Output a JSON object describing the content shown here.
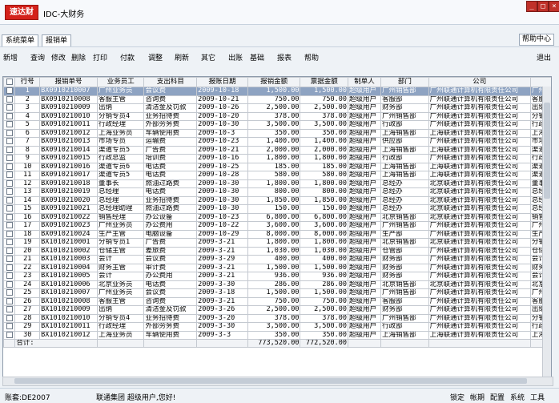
{
  "app": {
    "logo": "速达财",
    "title": "IDC-大财务"
  },
  "tabs": [
    "系统菜单",
    "报销单"
  ],
  "help_label": "帮助中心",
  "menu": [
    "新增",
    "查询",
    "修改",
    "删除",
    "打印",
    "付款",
    "调整",
    "刷新",
    "其它",
    "出账",
    "基础",
    "报表",
    "帮助"
  ],
  "exit_label": "退出",
  "columns": [
    "行号",
    "报销单号",
    "业务员工",
    "支出科目",
    "报账日期",
    "报销金额",
    "票据金额",
    "制单人",
    "部门",
    "公司"
  ],
  "rows": [
    [
      "1",
      "BX0910210007",
      "广州业务员",
      "会议费",
      "2009-10-18",
      "1,500.00",
      "1,500.00",
      "超级用户",
      "广州销售部",
      "广州联通计算机有限责任公司",
      "广州"
    ],
    [
      "2",
      "BX0910210008",
      "客服主管",
      "咨询费",
      "2009-10-21",
      "750.00",
      "750.00",
      "超级用户",
      "客服部",
      "广州联通计算机有限责任公司",
      "客服"
    ],
    [
      "3",
      "BX0910210009",
      "出纳",
      "清洁金及罚款",
      "2009-10-26",
      "2,500.00",
      "2,500.00",
      "超级用户",
      "财务部",
      "广州联通计算机有限责任公司",
      "出纳"
    ],
    [
      "4",
      "BX0910210010",
      "分销专员4",
      "业务招待费",
      "2009-10-20",
      "378.00",
      "378.00",
      "超级用户",
      "广州销售部",
      "广州联通计算机有限责任公司",
      "分销专"
    ],
    [
      "5",
      "BX0910210011",
      "行政经理",
      "外部劳务费",
      "2009-10-30",
      "3,500.00",
      "3,500.00",
      "超级用户",
      "行政部",
      "广州联通计算机有限责任公司",
      "行政经"
    ],
    [
      "6",
      "BX0910210012",
      "上海业务员",
      "车辆使用费",
      "2009-10-3",
      "350.00",
      "350.00",
      "超级用户",
      "上海销售部",
      "上海联通计算机有限责任公司",
      "上海业"
    ],
    [
      "7",
      "BX0910210013",
      "市场专员",
      "运输费",
      "2009-10-23",
      "1,400.00",
      "1,400.00",
      "超级用户",
      "供应部",
      "广州联通计算机有限责任公司",
      "市场专"
    ],
    [
      "8",
      "BX0910210014",
      "渠道专员5",
      "广告费",
      "2009-10-21",
      "2,000.00",
      "2,000.00",
      "超级用户",
      "上海销售部",
      "上海联通计算机有限责任公司",
      "渠道专"
    ],
    [
      "9",
      "BX0910210015",
      "行政总监",
      "培训费",
      "2009-10-16",
      "1,800.00",
      "1,800.00",
      "超级用户",
      "行政部",
      "广州联通计算机有限责任公司",
      "行政总"
    ],
    [
      "10",
      "BX0910210016",
      "渠道专员6",
      "电话费",
      "2009-10-25",
      "185.00",
      "185.00",
      "超级用户",
      "上海销售部",
      "上海联通计算机有限责任公司",
      "渠道专"
    ],
    [
      "11",
      "BX0910210017",
      "渠道专员5",
      "电话费",
      "2009-10-28",
      "580.00",
      "580.00",
      "超级用户",
      "上海销售部",
      "上海联通计算机有限责任公司",
      "渠道专"
    ],
    [
      "12",
      "BX0910210018",
      "董事长",
      "燃油过路费",
      "2009-10-30",
      "1,800.00",
      "1,800.00",
      "超级用户",
      "总经办",
      "北京联通计算机有限责任公司",
      "董事长"
    ],
    [
      "13",
      "BX0910210019",
      "总经理",
      "电话费",
      "2009-10-30",
      "800.00",
      "800.00",
      "超级用户",
      "总经办",
      "北京联通计算机有限责任公司",
      "总经理"
    ],
    [
      "14",
      "BX0910210020",
      "总经理",
      "业务招待费",
      "2009-10-30",
      "1,850.00",
      "1,850.00",
      "超级用户",
      "总经办",
      "北京联通计算机有限责任公司",
      "总经理"
    ],
    [
      "15",
      "BX0910210021",
      "总经理助理",
      "燃油过路费",
      "2009-10-30",
      "150.00",
      "150.00",
      "超级用户",
      "总经办",
      "北京联通计算机有限责任公司",
      "总经理"
    ],
    [
      "16",
      "BX0910210022",
      "销售经理",
      "办公设备",
      "2009-10-23",
      "6,800.00",
      "6,800.00",
      "超级用户",
      "北京销售部",
      "北京联通计算机有限责任公司",
      "销售经"
    ],
    [
      "17",
      "BX0910210023",
      "广州业务员",
      "办公费用",
      "2009-10-22",
      "3,600.00",
      "3,600.00",
      "超级用户",
      "广州销售部",
      "广州联通计算机有限责任公司",
      "广州业"
    ],
    [
      "18",
      "BX0910210024",
      "生产主管",
      "电脑设备",
      "2009-10-29",
      "8,000.00",
      "8,000.00",
      "超级用户",
      "生产部",
      "广州联通计算机有限责任公司",
      "生产主"
    ],
    [
      "19",
      "BX1010210001",
      "分销专员1",
      "广告费",
      "2009-3-21",
      "1,800.00",
      "1,800.00",
      "超级用户",
      "北京销售部",
      "北京联通计算机有限责任公司",
      "分销专"
    ],
    [
      "20",
      "BX1010210002",
      "仓储主管",
      "差旅费",
      "2009-3-21",
      "1,030.00",
      "1,030.00",
      "超级用户",
      "仓管部",
      "广州联通计算机有限责任公司",
      "仓储主"
    ],
    [
      "21",
      "BX1010210003",
      "会计",
      "会议费",
      "2009-3-29",
      "400.00",
      "400.00",
      "超级用户",
      "财务部",
      "广州联通计算机有限责任公司",
      "会计"
    ],
    [
      "22",
      "BX1010210004",
      "财务主管",
      "审计费",
      "2009-3-21",
      "1,500.00",
      "1,500.00",
      "超级用户",
      "财务部",
      "广州联通计算机有限责任公司",
      "财务主"
    ],
    [
      "23",
      "BX1010210005",
      "会计",
      "办公费用",
      "2009-3-21",
      "936.00",
      "936.00",
      "超级用户",
      "财务部",
      "广州联通计算机有限责任公司",
      "会计"
    ],
    [
      "24",
      "BX1010210006",
      "北京业务员",
      "电话费",
      "2009-3-30",
      "286.00",
      "286.00",
      "超级用户",
      "北京销售部",
      "北京联通计算机有限责任公司",
      "北京业"
    ],
    [
      "25",
      "BX1010210007",
      "广州业务员",
      "会议费",
      "2009-3-18",
      "1,500.00",
      "1,500.00",
      "超级用户",
      "广州销售部",
      "广州联通计算机有限责任公司",
      "广州业"
    ],
    [
      "26",
      "BX1010210008",
      "客服主管",
      "咨询费",
      "2009-3-21",
      "750.00",
      "750.00",
      "超级用户",
      "客服部",
      "广州联通计算机有限责任公司",
      "客服主"
    ],
    [
      "27",
      "BX1010210009",
      "出纳",
      "清洁金及罚款",
      "2009-3-26",
      "2,500.00",
      "2,500.00",
      "超级用户",
      "财务部",
      "广州联通计算机有限责任公司",
      "出纳"
    ],
    [
      "28",
      "BX1010210010",
      "分销专员4",
      "业务招待费",
      "2009-3-20",
      "378.00",
      "378.00",
      "超级用户",
      "广州销售部",
      "广州联通计算机有限责任公司",
      "分销专"
    ],
    [
      "29",
      "BX1010210011",
      "行政经理",
      "外部劳务费",
      "2009-3-30",
      "3,500.00",
      "3,500.00",
      "超级用户",
      "行政部",
      "广州联通计算机有限责任公司",
      "行政经"
    ],
    [
      "30",
      "BX1010210012",
      "上海业务员",
      "车辆使用费",
      "2009-3-3",
      "350.00",
      "350.00",
      "超级用户",
      "上海销售部",
      "上海联通计算机有限责任公司",
      "上海业"
    ]
  ],
  "totals": {
    "label": "合计:",
    "amount": "773,520.00",
    "invoice": "772,520.00"
  },
  "status": {
    "user": "账套:DE2007",
    "company": "联通集团 超级用户,您好!",
    "right": [
      "锁定",
      "帐期",
      "配置",
      "系统",
      "工具"
    ]
  }
}
